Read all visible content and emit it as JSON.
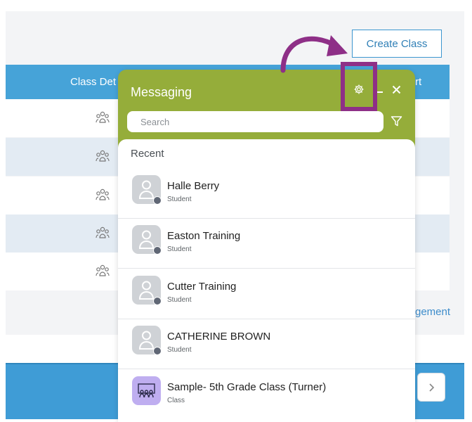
{
  "page": {
    "create_class_label": "Create Class",
    "table_header_left": "Class Det",
    "table_header_right": "rt",
    "management_link": "gement"
  },
  "messaging": {
    "title": "Messaging",
    "search_placeholder": "Search",
    "recent_label": "Recent",
    "contacts": [
      {
        "name": "Halle Berry",
        "type": "Student",
        "icon": "person-icon"
      },
      {
        "name": "Easton Training",
        "type": "Student",
        "icon": "person-icon"
      },
      {
        "name": "Cutter Training",
        "type": "Student",
        "icon": "person-icon"
      },
      {
        "name": "CATHERINE BROWN",
        "type": "Student",
        "icon": "person-icon"
      },
      {
        "name": "Sample- 5th Grade Class (Turner)",
        "type": "Class",
        "icon": "classroom-icon"
      }
    ]
  },
  "colors": {
    "messaging_green": "#95ad3a",
    "header_blue": "#46a3d8",
    "callout_purple": "#8e2f87"
  }
}
